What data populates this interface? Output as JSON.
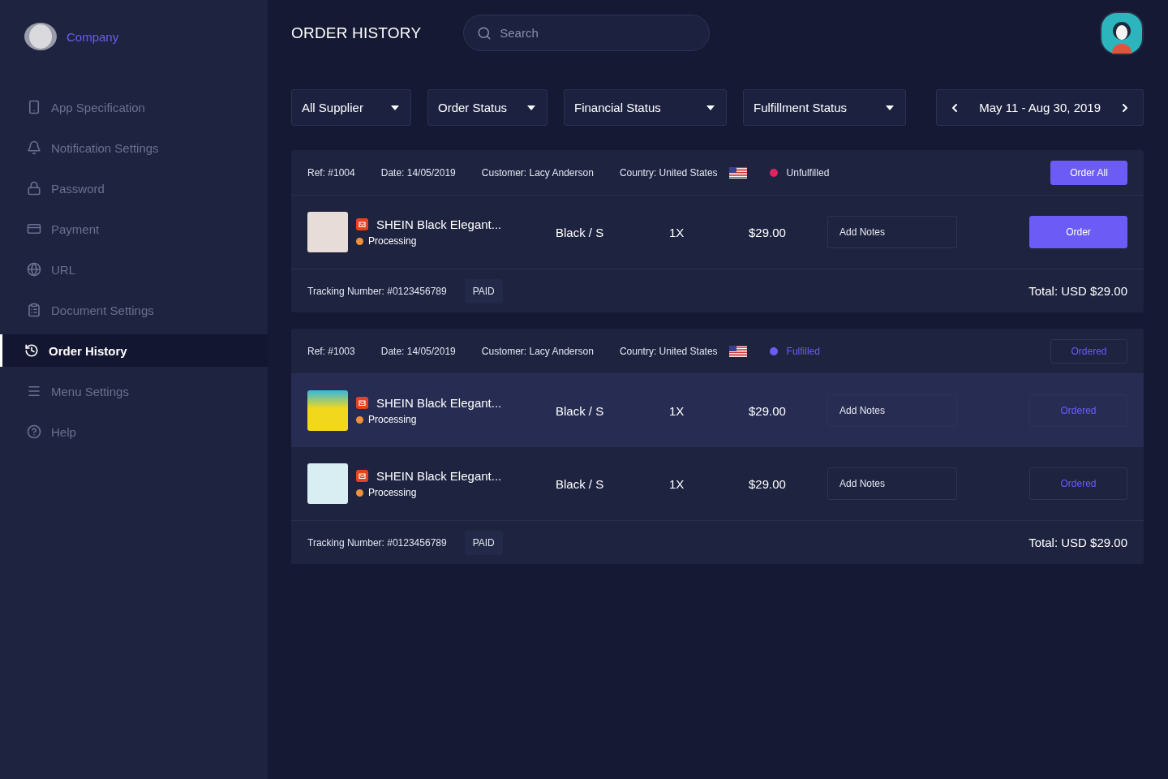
{
  "sidebar": {
    "brand": "Company",
    "items": [
      {
        "label": "App Specification",
        "selected": false
      },
      {
        "label": "Notification Settings",
        "selected": false
      },
      {
        "label": "Password",
        "selected": false
      },
      {
        "label": "Payment",
        "selected": false
      },
      {
        "label": "URL",
        "selected": false
      },
      {
        "label": "Document Settings",
        "selected": false
      },
      {
        "label": "Order History",
        "selected": true
      },
      {
        "label": "Menu Settings",
        "selected": false
      },
      {
        "label": "Help",
        "selected": false
      }
    ]
  },
  "header": {
    "title": "ORDER HISTORY",
    "search": {
      "placeholder": "Search"
    }
  },
  "filters": [
    "All Supplier",
    "Order Status",
    "Financial Status",
    "Fulfillment Status"
  ],
  "date_range": "May 11 - Aug 30, 2019",
  "orders": [
    {
      "ref": "Ref: #1004",
      "date": "Date: 14/05/2019",
      "customer": "Customer: Lacy Anderson",
      "country": "Country: United States",
      "status": {
        "label": "Unfulfilled",
        "color": "#e0245e"
      },
      "header_action": {
        "label": "Order All",
        "kind": "primary"
      },
      "items": [
        {
          "name": "SHEIN Black Elegant...",
          "status": {
            "label": "Processing",
            "color": "#f0923a"
          },
          "variant": "Black / S",
          "qty": "1X",
          "price": "$29.00",
          "notes": {
            "placeholder": "Add Notes"
          },
          "action": {
            "label": "Order",
            "kind": "primary"
          },
          "highlighted": false
        }
      ],
      "tracking": "Tracking Number: #0123456789",
      "payment": "PAID",
      "total": "Total: USD $29.00"
    },
    {
      "ref": "Ref: #1003",
      "date": "Date: 14/05/2019",
      "customer": "Customer: Lacy Anderson",
      "country": "Country: United States",
      "status": {
        "label": "Fulfilled",
        "color": "#6c5cf5"
      },
      "header_action": {
        "label": "Ordered",
        "kind": "outline"
      },
      "items": [
        {
          "name": "SHEIN Black Elegant...",
          "status": {
            "label": "Processing",
            "color": "#f0923a"
          },
          "variant": "Black / S",
          "qty": "1X",
          "price": "$29.00",
          "notes": {
            "placeholder": "Add Notes"
          },
          "action": {
            "label": "Ordered",
            "kind": "outline"
          },
          "highlighted": true
        },
        {
          "name": "SHEIN Black Elegant...",
          "status": {
            "label": "Processing",
            "color": "#f0923a"
          },
          "variant": "Black / S",
          "qty": "1X",
          "price": "$29.00",
          "notes": {
            "placeholder": "Add Notes"
          },
          "action": {
            "label": "Ordered",
            "kind": "outline"
          },
          "highlighted": false
        }
      ],
      "tracking": "Tracking Number: #0123456789",
      "payment": "PAID",
      "total": "Total: USD $29.00"
    }
  ]
}
